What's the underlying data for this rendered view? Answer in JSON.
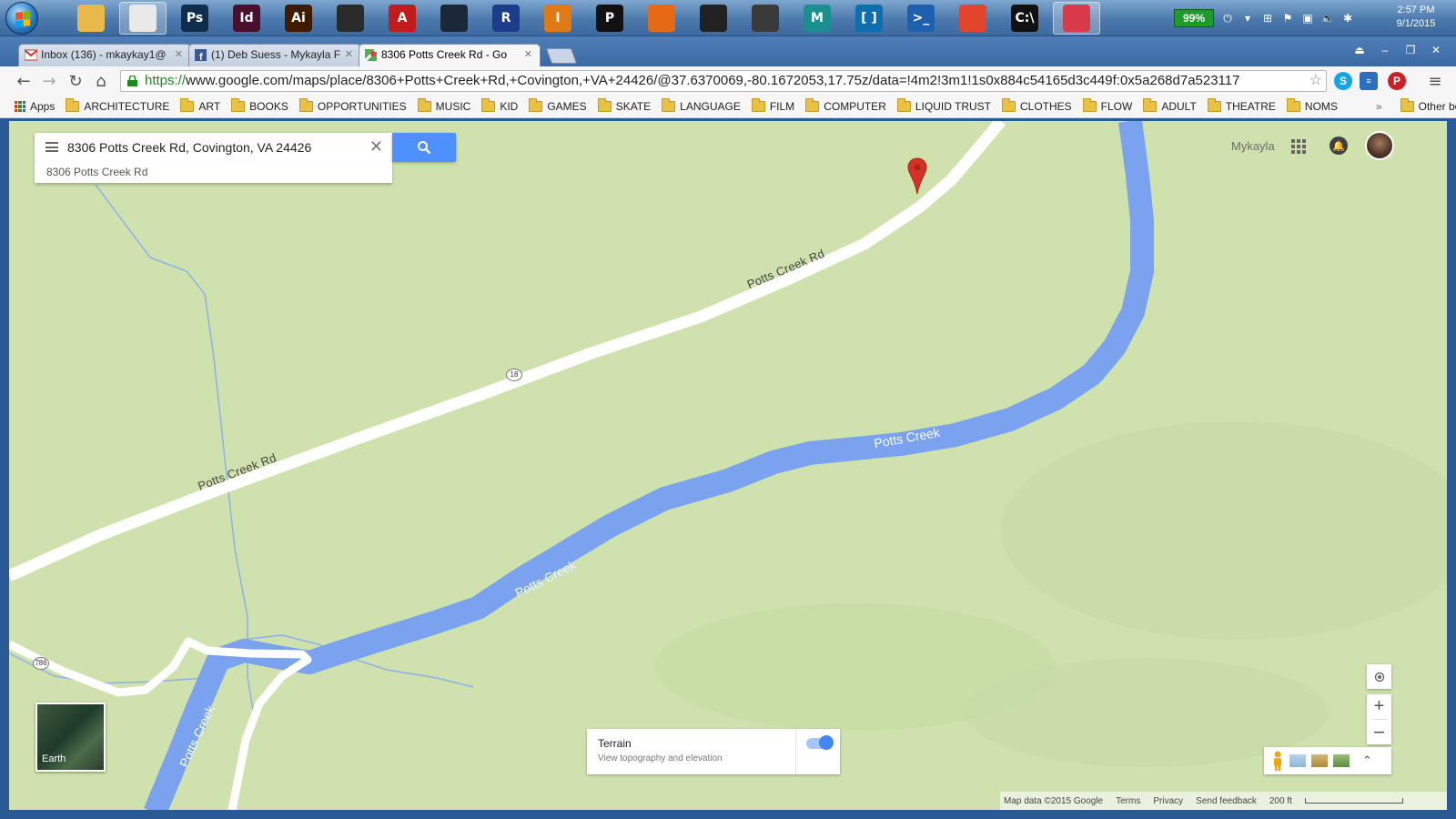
{
  "taskbar": {
    "battery": "99%",
    "clock_time": "2:57 PM",
    "clock_date": "9/1/2015",
    "apps": [
      {
        "name": "file-explorer-icon",
        "color": "#e8b84a",
        "label": ""
      },
      {
        "name": "chrome-icon",
        "color": "#e9e9e9",
        "label": ""
      },
      {
        "name": "photoshop-icon",
        "color": "#0f2e4d",
        "label": "Ps"
      },
      {
        "name": "indesign-icon",
        "color": "#4a0f2c",
        "label": "Id"
      },
      {
        "name": "illustrator-icon",
        "color": "#3d1c00",
        "label": "Ai"
      },
      {
        "name": "inkscape-icon",
        "color": "#2b2b2b",
        "label": ""
      },
      {
        "name": "acrobat-icon",
        "color": "#c21b1b",
        "label": "A"
      },
      {
        "name": "steam-icon",
        "color": "#1b2838",
        "label": ""
      },
      {
        "name": "revit-icon",
        "color": "#1c3d8a",
        "label": "R"
      },
      {
        "name": "imposition-icon",
        "color": "#e07a15",
        "label": "I"
      },
      {
        "name": "p-app-icon",
        "color": "#111111",
        "label": "P"
      },
      {
        "name": "firefox-icon",
        "color": "#e66a16",
        "label": ""
      },
      {
        "name": "unity-icon",
        "color": "#222222",
        "label": ""
      },
      {
        "name": "aperture-icon",
        "color": "#3a3a3a",
        "label": ""
      },
      {
        "name": "maya-icon",
        "color": "#1a8f8f",
        "label": "M"
      },
      {
        "name": "bracket-app-icon",
        "color": "#0e6fae",
        "label": "[ ]"
      },
      {
        "name": "powershell-icon",
        "color": "#1f5fb0",
        "label": ">_"
      },
      {
        "name": "git-icon",
        "color": "#e2452c",
        "label": ""
      },
      {
        "name": "command-prompt-icon",
        "color": "#111111",
        "label": "C:\\"
      },
      {
        "name": "pinwheel-app-icon",
        "color": "#d93a4a",
        "label": ""
      }
    ]
  },
  "browser": {
    "tabs": [
      {
        "title": "Inbox (136) - mkaykay1@",
        "favicon": "gmail"
      },
      {
        "title": "(1) Deb Suess - Mykayla F",
        "favicon": "facebook"
      },
      {
        "title": "8306 Potts Creek Rd - Go",
        "favicon": "maps"
      }
    ],
    "url_scheme": "https://",
    "url_rest": "www.google.com/maps/place/8306+Potts+Creek+Rd,+Covington,+VA+24426/@37.6370069,-80.1672053,17.75z/data=!4m2!3m1!1s0x884c54165d3c449f:0x5a268d7a523117",
    "bookmarks": [
      "Apps",
      "ARCHITECTURE",
      "ART",
      "BOOKS",
      "OPPORTUNITIES",
      "MUSIC",
      "KID",
      "GAMES",
      "SKATE",
      "LANGUAGE",
      "FILM",
      "COMPUTER",
      "LIQUID TRUST",
      "CLOTHES",
      "FLOW",
      "ADULT",
      "THEATRE",
      "NOMS"
    ],
    "bookmarks_overflow": "»",
    "other_bookmarks": "Other bookmarks"
  },
  "maps": {
    "search_value": "8306 Potts Creek Rd, Covington, VA 24426",
    "suggestion": "8306 Potts Creek Rd",
    "user_name": "Mykayla",
    "earth_label": "Earth",
    "terrain_title": "Terrain",
    "terrain_subtitle": "View topography and elevation",
    "terrain_enabled": true,
    "road_labels": [
      "Potts Creek Rd",
      "Potts Creek Rd"
    ],
    "creek_labels": [
      "Potts Creek",
      "Potts Creek",
      "Potts Creek"
    ],
    "route_shields": [
      "18",
      "786"
    ],
    "footer": {
      "map_data": "Map data ©2015 Google",
      "terms": "Terms",
      "privacy": "Privacy",
      "feedback": "Send feedback",
      "scale": "200 ft"
    },
    "colors": {
      "land": "#cfe2ad",
      "water": "#7aa2ef",
      "road": "#ffffff",
      "pin": "#d93025",
      "search_button": "#4d90fe"
    }
  }
}
